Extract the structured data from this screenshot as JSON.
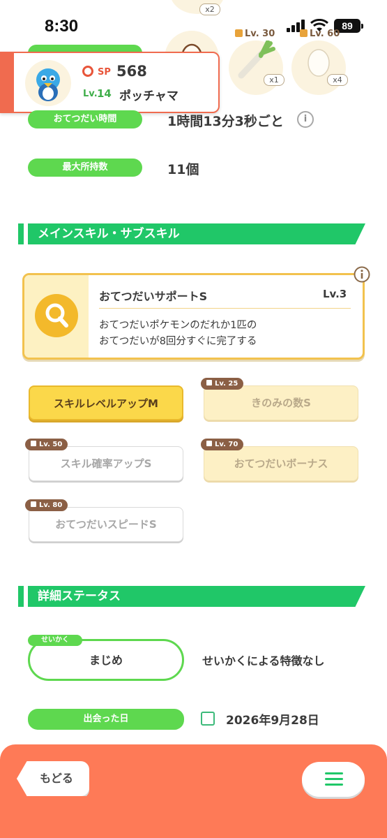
{
  "status_bar": {
    "time": "8:30",
    "battery": "89"
  },
  "ingredients": {
    "top_qty": "x2",
    "slots": [
      {
        "locked_level": "",
        "qty": ""
      },
      {
        "locked_level": "Lv. 30",
        "qty": "x1"
      },
      {
        "locked_level": "Lv. 60",
        "qty": "x4"
      }
    ]
  },
  "header": {
    "sp_label": "SP",
    "sp_value": "568",
    "level_label": "Lv.",
    "level_value": "14",
    "name": "ポッチャマ"
  },
  "stats": {
    "help_time_label": "おてつだい時間",
    "help_time_value": "1時間13分3秒ごと",
    "max_carry_label": "最大所持数",
    "max_carry_value": "11個"
  },
  "skills_section": {
    "title": "メインスキル・サブスキル",
    "main_skill": {
      "name": "おてつだいサポートS",
      "level": "Lv.3",
      "desc_line1": "おてつだいポケモンのだれか1匹の",
      "desc_line2": "おてつだいが8回分すぐに完了する"
    },
    "sub_skills": [
      {
        "label": "スキルレベルアップM",
        "lock": ""
      },
      {
        "label": "きのみの数S",
        "lock": "Lv. 25"
      },
      {
        "label": "スキル確率アップS",
        "lock": "Lv. 50"
      },
      {
        "label": "おてつだいボーナス",
        "lock": "Lv. 70"
      },
      {
        "label": "おてつだいスピードS",
        "lock": "Lv. 80"
      }
    ]
  },
  "details_section": {
    "title": "詳細ステータス",
    "nature_tag": "せいかく",
    "nature_value": "まじめ",
    "nature_desc": "せいかくによる特徴なし",
    "met_label": "出会った日",
    "met_date": "2026年9月28日"
  },
  "footer": {
    "back_label": "もどる"
  },
  "colors": {
    "accent_green": "#20c768",
    "pill_green": "#5ed84f",
    "footer_coral": "#fe7a57",
    "skill_gold": "#f2c24e"
  }
}
